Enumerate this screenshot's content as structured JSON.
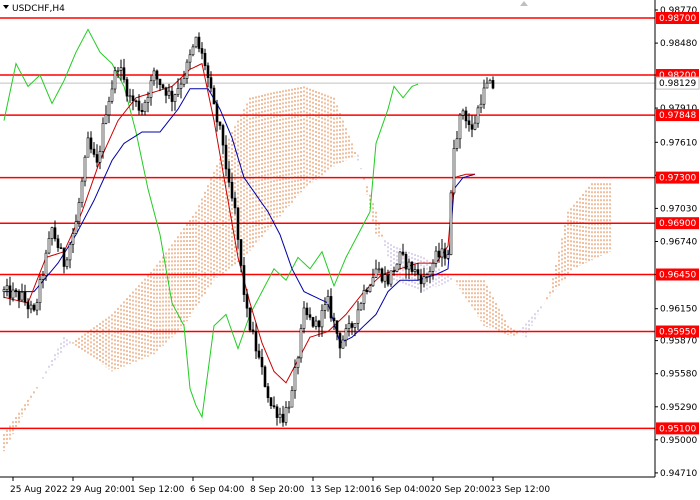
{
  "chart_data": {
    "type": "candlestick",
    "symbol_label": "USDCHF,H4",
    "x_tick_labels": [
      "25 Aug 2022",
      "29 Aug 20:00",
      "1 Sep 12:00",
      "6 Sep 04:00",
      "8 Sep 20:00",
      "13 Sep 12:00",
      "16 Sep 04:00",
      "20 Sep 20:00",
      "23 Sep 12:00"
    ],
    "x_tick_bars": [
      3,
      23,
      43,
      63,
      83,
      103,
      123,
      143,
      163
    ],
    "bar_count": 176,
    "ylim": [
      0.94674,
      0.98858
    ],
    "y_ticks": [
      0.9877,
      0.9848,
      0.982,
      0.9791,
      0.9761,
      0.9732,
      0.9703,
      0.9674,
      0.9645,
      0.9615,
      0.9587,
      0.9558,
      0.9529,
      0.95,
      0.9471
    ],
    "y_tick_labels": [
      "0.98770",
      "0.98480",
      "0.98200",
      "0.97910",
      "0.97610",
      "0.97320",
      "0.97030",
      "0.96740",
      "0.96450",
      "0.96150",
      "0.95870",
      "0.95580",
      "0.95290",
      "0.95000",
      "0.94710"
    ],
    "current_price": 0.98129,
    "current_price_label": "0.98129",
    "levels": [
      {
        "value": 0.987,
        "label": "0.98700"
      },
      {
        "value": 0.982,
        "label": "0.98200"
      },
      {
        "value": 0.97848,
        "label": "0.97848"
      },
      {
        "value": 0.973,
        "label": "0.97300"
      },
      {
        "value": 0.969,
        "label": "0.96900"
      },
      {
        "value": 0.9645,
        "label": "0.96450"
      },
      {
        "value": 0.9595,
        "label": "0.95950"
      },
      {
        "value": 0.951,
        "label": "0.95100"
      }
    ],
    "close_anchors": [
      [
        0,
        0.963
      ],
      [
        6,
        0.9625
      ],
      [
        10,
        0.961
      ],
      [
        16,
        0.9685
      ],
      [
        20,
        0.9655
      ],
      [
        24,
        0.969
      ],
      [
        28,
        0.976
      ],
      [
        31,
        0.974
      ],
      [
        34,
        0.979
      ],
      [
        38,
        0.983
      ],
      [
        42,
        0.98
      ],
      [
        46,
        0.979
      ],
      [
        50,
        0.982
      ],
      [
        53,
        0.981
      ],
      [
        56,
        0.98
      ],
      [
        60,
        0.982
      ],
      [
        64,
        0.985
      ],
      [
        67,
        0.983
      ],
      [
        70,
        0.979
      ],
      [
        73,
        0.976
      ],
      [
        75,
        0.972
      ],
      [
        77,
        0.97
      ],
      [
        79,
        0.965
      ],
      [
        81,
        0.961
      ],
      [
        84,
        0.958
      ],
      [
        86,
        0.956
      ],
      [
        89,
        0.953
      ],
      [
        93,
        0.952
      ],
      [
        96,
        0.954
      ],
      [
        100,
        0.961
      ],
      [
        104,
        0.96
      ],
      [
        108,
        0.962
      ],
      [
        112,
        0.9585
      ],
      [
        116,
        0.96
      ],
      [
        120,
        0.963
      ],
      [
        124,
        0.965
      ],
      [
        128,
        0.964
      ],
      [
        132,
        0.966
      ],
      [
        136,
        0.965
      ],
      [
        140,
        0.964
      ],
      [
        144,
        0.966
      ],
      [
        148,
        0.9665
      ],
      [
        150,
        0.976
      ],
      [
        153,
        0.979
      ],
      [
        156,
        0.977
      ],
      [
        159,
        0.98
      ],
      [
        161,
        0.981
      ],
      [
        163,
        0.981
      ]
    ],
    "tenkan_anchors": [
      [
        0,
        0.9625
      ],
      [
        8,
        0.962
      ],
      [
        14,
        0.966
      ],
      [
        20,
        0.9665
      ],
      [
        26,
        0.97
      ],
      [
        32,
        0.9745
      ],
      [
        38,
        0.978
      ],
      [
        44,
        0.98
      ],
      [
        50,
        0.9805
      ],
      [
        56,
        0.981
      ],
      [
        62,
        0.9825
      ],
      [
        66,
        0.983
      ],
      [
        70,
        0.978
      ],
      [
        74,
        0.972
      ],
      [
        78,
        0.966
      ],
      [
        82,
        0.962
      ],
      [
        86,
        0.9585
      ],
      [
        90,
        0.956
      ],
      [
        94,
        0.955
      ],
      [
        98,
        0.957
      ],
      [
        102,
        0.959
      ],
      [
        108,
        0.9595
      ],
      [
        114,
        0.961
      ],
      [
        120,
        0.963
      ],
      [
        126,
        0.9645
      ],
      [
        132,
        0.965
      ],
      [
        138,
        0.9655
      ],
      [
        144,
        0.9655
      ],
      [
        148,
        0.967
      ],
      [
        150,
        0.973
      ],
      [
        154,
        0.9733
      ],
      [
        157,
        0.9733
      ]
    ],
    "kijun_anchors": [
      [
        0,
        0.963
      ],
      [
        10,
        0.963
      ],
      [
        18,
        0.9655
      ],
      [
        24,
        0.968
      ],
      [
        30,
        0.971
      ],
      [
        36,
        0.9745
      ],
      [
        40,
        0.976
      ],
      [
        46,
        0.977
      ],
      [
        52,
        0.977
      ],
      [
        58,
        0.979
      ],
      [
        62,
        0.9808
      ],
      [
        68,
        0.9808
      ],
      [
        72,
        0.979
      ],
      [
        76,
        0.9765
      ],
      [
        80,
        0.973
      ],
      [
        84,
        0.9715
      ],
      [
        88,
        0.97
      ],
      [
        92,
        0.968
      ],
      [
        96,
        0.965
      ],
      [
        100,
        0.963
      ],
      [
        104,
        0.9625
      ],
      [
        108,
        0.962
      ],
      [
        112,
        0.9585
      ],
      [
        116,
        0.959
      ],
      [
        120,
        0.96
      ],
      [
        124,
        0.961
      ],
      [
        128,
        0.963
      ],
      [
        132,
        0.964
      ],
      [
        138,
        0.964
      ],
      [
        144,
        0.9645
      ],
      [
        148,
        0.965
      ],
      [
        150,
        0.972
      ],
      [
        153,
        0.973
      ],
      [
        157,
        0.9733
      ]
    ],
    "chikou_anchors": [
      [
        0,
        0.978
      ],
      [
        4,
        0.983
      ],
      [
        8,
        0.981
      ],
      [
        12,
        0.982
      ],
      [
        16,
        0.9795
      ],
      [
        20,
        0.9815
      ],
      [
        24,
        0.984
      ],
      [
        28,
        0.986
      ],
      [
        32,
        0.984
      ],
      [
        36,
        0.983
      ],
      [
        40,
        0.981
      ],
      [
        44,
        0.977
      ],
      [
        48,
        0.972
      ],
      [
        52,
        0.968
      ],
      [
        56,
        0.962
      ],
      [
        60,
        0.96
      ],
      [
        62,
        0.9545
      ],
      [
        64,
        0.953
      ],
      [
        66,
        0.952
      ],
      [
        68,
        0.956
      ],
      [
        70,
        0.96
      ],
      [
        74,
        0.961
      ],
      [
        78,
        0.958
      ],
      [
        82,
        0.961
      ],
      [
        86,
        0.963
      ],
      [
        90,
        0.965
      ],
      [
        94,
        0.964
      ],
      [
        98,
        0.966
      ],
      [
        102,
        0.965
      ],
      [
        106,
        0.9665
      ],
      [
        110,
        0.9635
      ],
      [
        114,
        0.966
      ],
      [
        118,
        0.968
      ],
      [
        122,
        0.97
      ],
      [
        124,
        0.976
      ],
      [
        128,
        0.979
      ],
      [
        130,
        0.981
      ],
      [
        133,
        0.98
      ],
      [
        136,
        0.981
      ],
      [
        138,
        0.9812
      ]
    ],
    "cloud_a_anchors": [
      [
        0,
        0.9505
      ],
      [
        20,
        0.958
      ],
      [
        36,
        0.961
      ],
      [
        50,
        0.965
      ],
      [
        64,
        0.97
      ],
      [
        76,
        0.977
      ],
      [
        82,
        0.98
      ],
      [
        90,
        0.9805
      ],
      [
        100,
        0.981
      ],
      [
        110,
        0.98
      ],
      [
        116,
        0.976
      ],
      [
        124,
        0.97
      ],
      [
        130,
        0.964
      ],
      [
        140,
        0.963
      ],
      [
        150,
        0.964
      ],
      [
        160,
        0.964
      ],
      [
        168,
        0.96
      ],
      [
        174,
        0.959
      ],
      [
        176,
        0.96
      ],
      [
        182,
        0.963
      ],
      [
        188,
        0.97
      ],
      [
        196,
        0.9725
      ],
      [
        202,
        0.9725
      ]
    ],
    "cloud_b_anchors": [
      [
        0,
        0.949
      ],
      [
        20,
        0.959
      ],
      [
        36,
        0.956
      ],
      [
        50,
        0.9575
      ],
      [
        60,
        0.96
      ],
      [
        70,
        0.964
      ],
      [
        80,
        0.966
      ],
      [
        90,
        0.969
      ],
      [
        100,
        0.972
      ],
      [
        110,
        0.974
      ],
      [
        118,
        0.975
      ],
      [
        124,
        0.968
      ],
      [
        130,
        0.967
      ],
      [
        140,
        0.966
      ],
      [
        150,
        0.964
      ],
      [
        160,
        0.96
      ],
      [
        170,
        0.959
      ],
      [
        180,
        0.962
      ],
      [
        190,
        0.965
      ],
      [
        202,
        0.9665
      ]
    ],
    "colors": {
      "level_line": "#ff0000",
      "level_label_bg": "#ff0000",
      "tenkan": "#cc0000",
      "kijun": "#0000aa",
      "chikou": "#22cc22",
      "cloud_bull": "#e07f3f",
      "cloud_bear": "#b8a8d8",
      "candle": "#000000",
      "grid": "#c0c0c0"
    }
  }
}
